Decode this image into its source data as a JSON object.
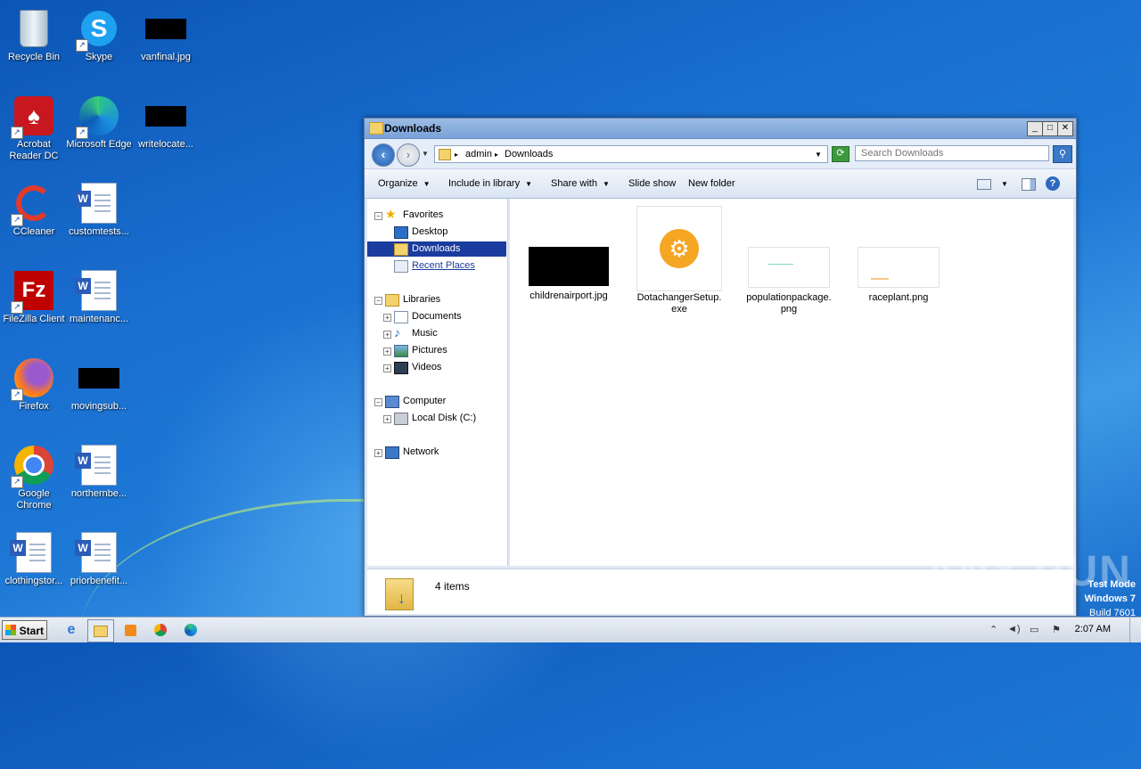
{
  "desktop": {
    "icons": [
      {
        "label": "Recycle Bin"
      },
      {
        "label": "Skype"
      },
      {
        "label": "vanfinal.jpg"
      },
      {
        "label": "Acrobat Reader DC"
      },
      {
        "label": "Microsoft Edge"
      },
      {
        "label": "writelocate..."
      },
      {
        "label": "CCleaner"
      },
      {
        "label": "customtests..."
      },
      {
        "label": "FileZilla Client"
      },
      {
        "label": "maintenanc..."
      },
      {
        "label": "Firefox"
      },
      {
        "label": "movingsub..."
      },
      {
        "label": "Google Chrome"
      },
      {
        "label": "northernbe..."
      },
      {
        "label": "clothingstor..."
      },
      {
        "label": "priorbenefit..."
      }
    ]
  },
  "window": {
    "title": "Downloads",
    "controls": {
      "minimize": "_",
      "maximize": "□",
      "close": "✕"
    },
    "address": {
      "crumbs": [
        "admin",
        "Downloads"
      ]
    },
    "search": {
      "placeholder": "Search Downloads"
    },
    "toolbar": {
      "organize": "Organize",
      "include": "Include in library",
      "share": "Share with",
      "slideshow": "Slide show",
      "newfolder": "New folder"
    },
    "nav": {
      "favorites": "Favorites",
      "desktop": "Desktop",
      "downloads": "Downloads",
      "recent": "Recent Places",
      "libraries": "Libraries",
      "documents": "Documents",
      "music": "Music",
      "pictures": "Pictures",
      "videos": "Videos",
      "computer": "Computer",
      "localdisk": "Local Disk (C:)",
      "network": "Network"
    },
    "files": [
      {
        "name": "childrenairport.jpg"
      },
      {
        "name1": "DotachangerSetup.",
        "name2": "exe"
      },
      {
        "name1": "populationpackage.",
        "name2": "png"
      },
      {
        "name": "raceplant.png"
      }
    ],
    "details": {
      "count": "4 items"
    }
  },
  "taskbar": {
    "start": "Start",
    "clock": "2:07 AM"
  },
  "watermark": {
    "line1": "Test Mode",
    "line2": "Windows 7",
    "line3": "Build 7601",
    "brand": "ANY RUN"
  },
  "colors": {
    "selection": "#1a3c9e",
    "desktop": "#1a6fd0"
  }
}
